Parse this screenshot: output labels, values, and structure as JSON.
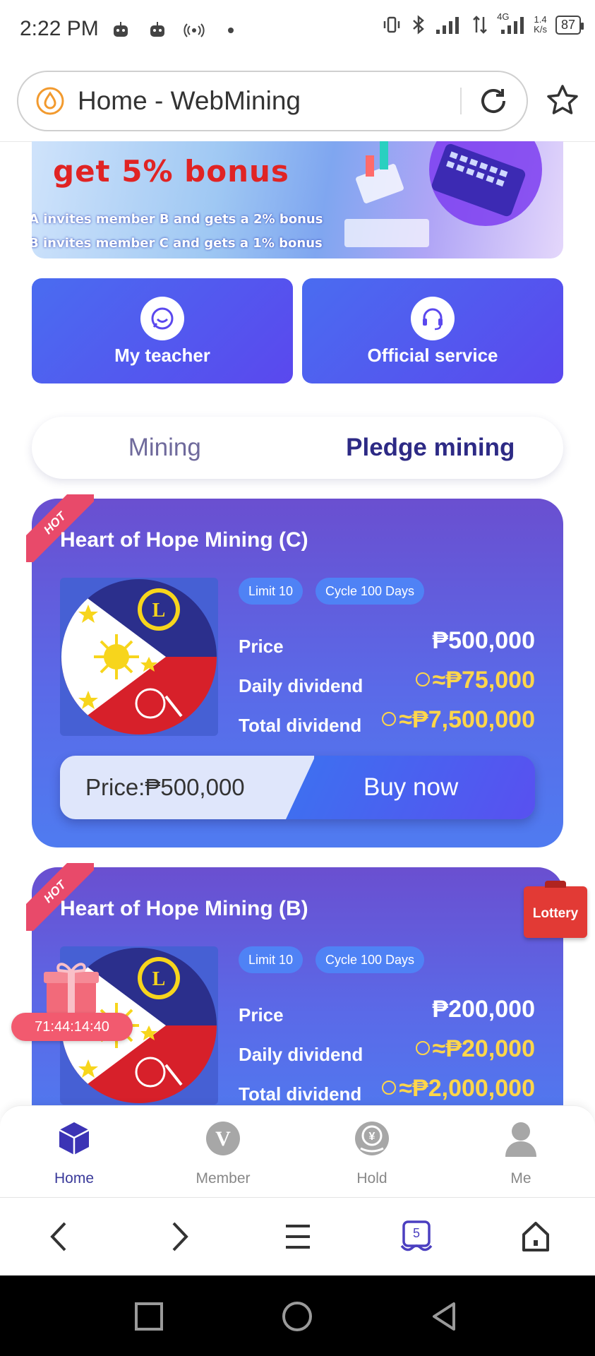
{
  "status_bar": {
    "time": "2:22 PM",
    "network": "4G",
    "speed_value": "1.4",
    "speed_unit": "K/s",
    "battery": "87"
  },
  "browser": {
    "page_title": "Home - WebMining"
  },
  "banner": {
    "headline": "get  5% bonus",
    "line1": "A invites member B and gets a 2% bonus",
    "line2": "B invites member C and gets a 1% bonus"
  },
  "services": {
    "teacher_label": "My teacher",
    "official_label": "Official service"
  },
  "tabs": [
    {
      "label": "Mining"
    },
    {
      "label": "Pledge mining"
    }
  ],
  "products": [
    {
      "badge": "HOT",
      "title": "Heart of Hope Mining (C)",
      "limit_tag": "Limit 10",
      "cycle_tag": "Cycle 100 Days",
      "price_label": "Price",
      "price_value": "₱500,000",
      "daily_label": "Daily dividend",
      "daily_value": "≈₱75,000",
      "total_label": "Total dividend",
      "total_value": "≈₱7,500,000",
      "buy_price": "Price:₱500,000",
      "buy_label": "Buy now"
    },
    {
      "badge": "HOT",
      "title": "Heart of Hope Mining (B)",
      "limit_tag": "Limit 10",
      "cycle_tag": "Cycle 100 Days",
      "price_label": "Price",
      "price_value": "₱200,000",
      "daily_label": "Daily dividend",
      "daily_value": "≈₱20,000",
      "total_label": "Total dividend",
      "total_value": "≈₱2,000,000"
    }
  ],
  "lottery_label": "Lottery",
  "gift_timer": "71:44:14:40",
  "app_nav": [
    {
      "label": "Home",
      "icon": "cube-icon",
      "active": true
    },
    {
      "label": "Member",
      "icon": "member-v-icon",
      "active": false
    },
    {
      "label": "Hold",
      "icon": "yen-coin-icon",
      "active": false
    },
    {
      "label": "Me",
      "icon": "person-icon",
      "active": false
    }
  ],
  "browser_toolbar": {
    "tab_count": "5"
  },
  "colors": {
    "primary": "#5a48ee",
    "accent_yellow": "#ffd64a",
    "hot_badge": "#e84a6a",
    "lottery": "#e23a35"
  }
}
